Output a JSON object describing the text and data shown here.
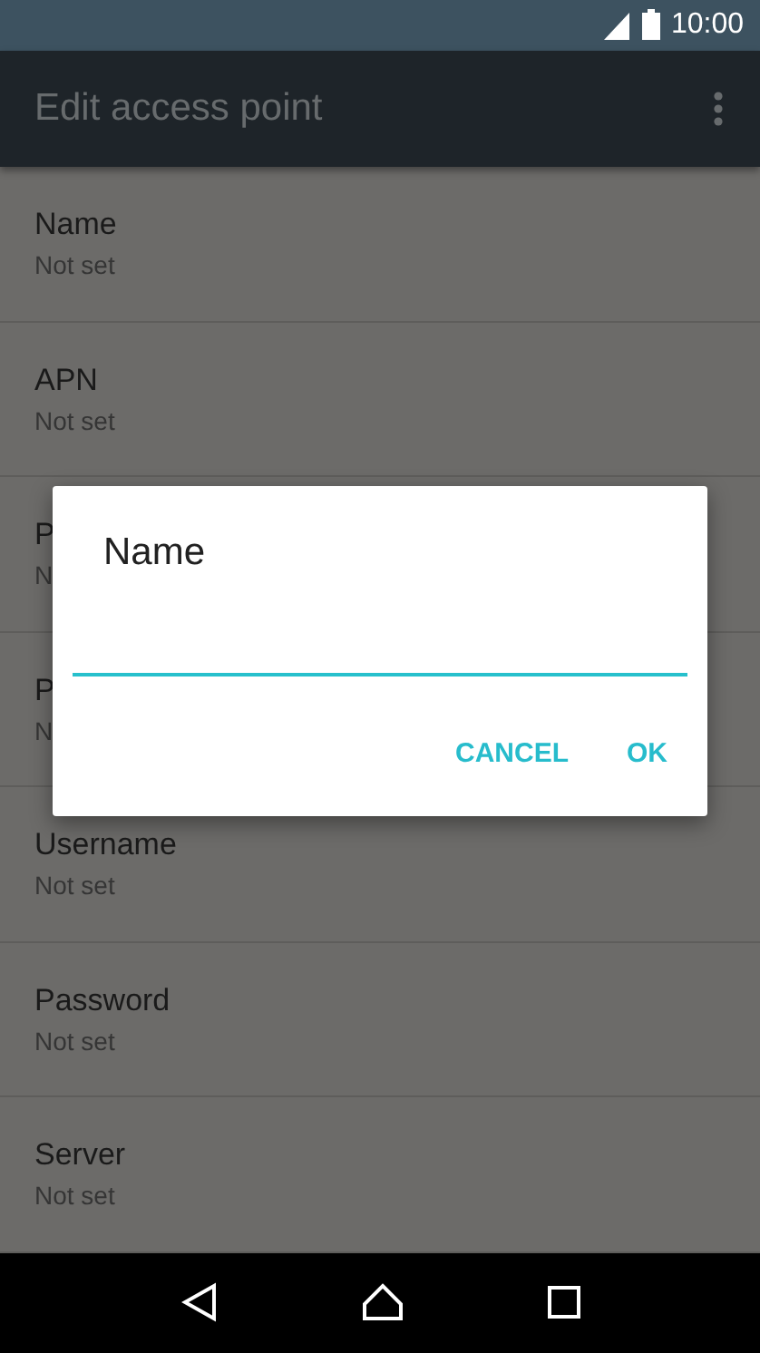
{
  "status_bar": {
    "time": "10:00"
  },
  "app_bar": {
    "title": "Edit access point"
  },
  "settings": [
    {
      "title": "Name",
      "value": "Not set"
    },
    {
      "title": "APN",
      "value": "Not set"
    },
    {
      "title": "P",
      "value": "N"
    },
    {
      "title": "P",
      "value": "N"
    },
    {
      "title": "Username",
      "value": "Not set"
    },
    {
      "title": "Password",
      "value": "Not set"
    },
    {
      "title": "Server",
      "value": "Not set"
    }
  ],
  "dialog": {
    "title": "Name",
    "buttons": [
      "CANCEL",
      "OK"
    ]
  }
}
